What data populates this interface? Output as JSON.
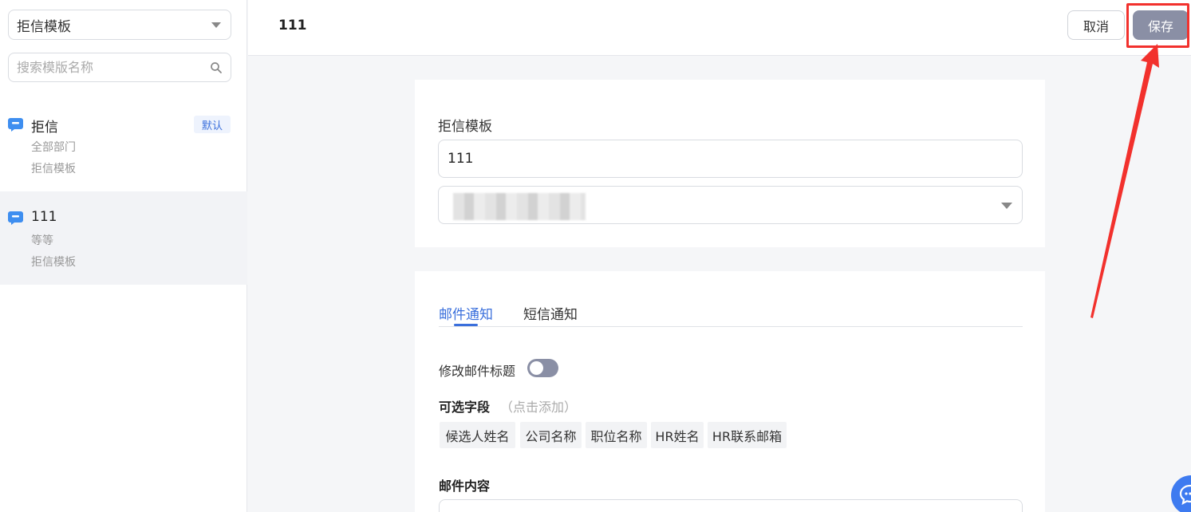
{
  "sidebar": {
    "type_select": "拒信模板",
    "search_placeholder": "搜索模版名称",
    "items": [
      {
        "name": "拒信",
        "badge": "默认",
        "department": "全部部门",
        "category": "拒信模板",
        "active": false
      },
      {
        "name": "111",
        "department": "等等",
        "category": "拒信模板",
        "active": true
      }
    ]
  },
  "header": {
    "title": "111",
    "cancel_label": "取消",
    "save_label": "保存"
  },
  "form": {
    "label": "拒信模板",
    "name_value": "111"
  },
  "notify": {
    "tabs": [
      "邮件通知",
      "短信通知"
    ],
    "active_tab": "邮件通知",
    "toggle_label": "修改邮件标题",
    "toggle_on": false,
    "fields_title": "可选字段",
    "fields_hint": "（点击添加）",
    "fields": [
      "候选人姓名",
      "公司名称",
      "职位名称",
      "HR姓名",
      "HR联系邮箱"
    ],
    "content_title": "邮件内容"
  },
  "colors": {
    "accent": "#3a6fdc",
    "save_button": "#8a8fa5",
    "annotation": "#f2312d"
  }
}
